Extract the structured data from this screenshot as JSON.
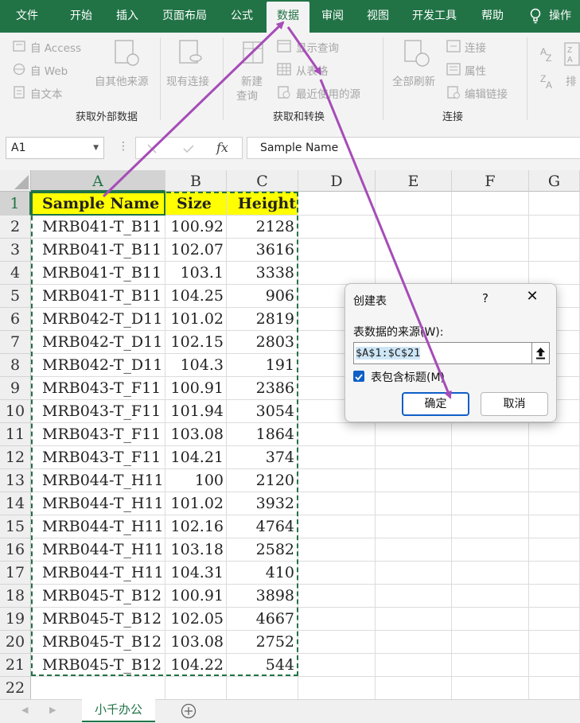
{
  "ribbon_tabs": [
    "文件",
    "开始",
    "插入",
    "页面布局",
    "公式",
    "数据",
    "审阅",
    "视图",
    "开发工具",
    "帮助",
    "操作"
  ],
  "ribbon": {
    "external": {
      "access": "自 Access",
      "web": "自 Web",
      "text": "自文本",
      "other": "自其他来源",
      "existing": "现有连接",
      "group": "获取外部数据"
    },
    "transform": {
      "new_query_1": "新建",
      "new_query_2": "查询",
      "show_queries": "显示查询",
      "from_table": "从表格",
      "recent_sources": "最近使用的源",
      "group": "获取和转换"
    },
    "connections": {
      "refresh_all": "全部刷新",
      "connections": "连接",
      "properties": "属性",
      "edit_links": "编辑链接",
      "group": "连接"
    },
    "sort": {
      "label": "排"
    }
  },
  "formula_bar": {
    "name_box": "A1",
    "fx": "fx",
    "formula": "Sample Name"
  },
  "columns": [
    "A",
    "B",
    "C",
    "D",
    "E",
    "F",
    "G"
  ],
  "header_row": [
    "Sample Name",
    "Size",
    "Height"
  ],
  "rows": [
    [
      "MRB041-T_B11",
      "100.92",
      "2128"
    ],
    [
      "MRB041-T_B11",
      "102.07",
      "3616"
    ],
    [
      "MRB041-T_B11",
      "103.1",
      "3338"
    ],
    [
      "MRB041-T_B11",
      "104.25",
      "906"
    ],
    [
      "MRB042-T_D11",
      "101.02",
      "2819"
    ],
    [
      "MRB042-T_D11",
      "102.15",
      "2803"
    ],
    [
      "MRB042-T_D11",
      "104.3",
      "191"
    ],
    [
      "MRB043-T_F11",
      "100.91",
      "2386"
    ],
    [
      "MRB043-T_F11",
      "101.94",
      "3054"
    ],
    [
      "MRB043-T_F11",
      "103.08",
      "1864"
    ],
    [
      "MRB043-T_F11",
      "104.21",
      "374"
    ],
    [
      "MRB044-T_H11",
      "100",
      "2120"
    ],
    [
      "MRB044-T_H11",
      "101.02",
      "3932"
    ],
    [
      "MRB044-T_H11",
      "102.16",
      "4764"
    ],
    [
      "MRB044-T_H11",
      "103.18",
      "2582"
    ],
    [
      "MRB044-T_H11",
      "104.31",
      "410"
    ],
    [
      "MRB045-T_B12",
      "100.91",
      "3898"
    ],
    [
      "MRB045-T_B12",
      "102.05",
      "4667"
    ],
    [
      "MRB045-T_B12",
      "103.08",
      "2752"
    ],
    [
      "MRB045-T_B12",
      "104.22",
      "544"
    ]
  ],
  "sheet_tab": "小千办公",
  "dialog": {
    "title": "创建表",
    "help": "?",
    "close": "✕",
    "source_label": "表数据的来源(W):",
    "source_value": "$A$1:$C$21",
    "has_headers": "表包含标题(M)",
    "has_headers_checked": true,
    "ok": "确定",
    "cancel": "取消"
  },
  "colors": {
    "excel_green": "#217346",
    "header_fill": "#ffff00",
    "arrow": "#a64cb8",
    "checkbox": "#0f5fc6"
  }
}
